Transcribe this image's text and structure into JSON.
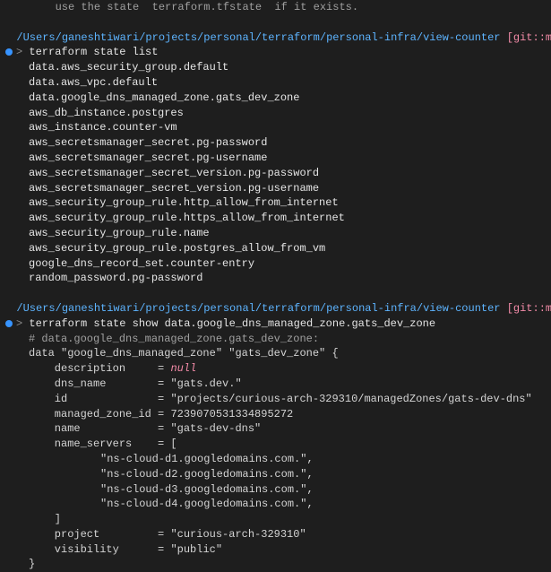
{
  "hint_line": "        use the state  terraform.tfstate  if it exists.",
  "path": "/Users/ganeshtiwari/projects/personal/terraform/personal-infra/view-counter",
  "git_label": "[git::ma",
  "cmd1": "terraform state list",
  "state_list": [
    "data.aws_security_group.default",
    "data.aws_vpc.default",
    "data.google_dns_managed_zone.gats_dev_zone",
    "aws_db_instance.postgres",
    "aws_instance.counter-vm",
    "aws_secretsmanager_secret.pg-password",
    "aws_secretsmanager_secret.pg-username",
    "aws_secretsmanager_secret_version.pg-password",
    "aws_secretsmanager_secret_version.pg-username",
    "aws_security_group_rule.http_allow_from_internet",
    "aws_security_group_rule.https_allow_from_internet",
    "aws_security_group_rule.name",
    "aws_security_group_rule.postgres_allow_from_vm",
    "google_dns_record_set.counter-entry",
    "random_password.pg-password"
  ],
  "cmd2": "terraform state show data.google_dns_managed_zone.gats_dev_zone",
  "comment2": "# data.google_dns_managed_zone.gats_dev_zone:",
  "data_decl": "data \"google_dns_managed_zone\" \"gats_dev_zone\" {",
  "attrs": {
    "description": {
      "label": "    description     = ",
      "value": "null",
      "isNull": true
    },
    "dns_name": {
      "label": "    dns_name        = ",
      "value": "\"gats.dev.\""
    },
    "id": {
      "label": "    id              = ",
      "value": "\"projects/curious-arch-329310/managedZones/gats-dev-dns\""
    },
    "managed_zone_id": {
      "label": "    managed_zone_id = ",
      "value": "7239070531334895272"
    },
    "name": {
      "label": "    name            = ",
      "value": "\"gats-dev-dns\""
    },
    "name_servers": {
      "label": "    name_servers    = ["
    },
    "project": {
      "label": "    project         = ",
      "value": "\"curious-arch-329310\""
    },
    "visibility": {
      "label": "    visibility      = ",
      "value": "\"public\""
    }
  },
  "name_servers": [
    "\"ns-cloud-d1.googledomains.com.\",",
    "\"ns-cloud-d2.googledomains.com.\",",
    "\"ns-cloud-d3.googledomains.com.\",",
    "\"ns-cloud-d4.googledomains.com.\","
  ],
  "ns_close": "    ]",
  "brace_close": "}"
}
